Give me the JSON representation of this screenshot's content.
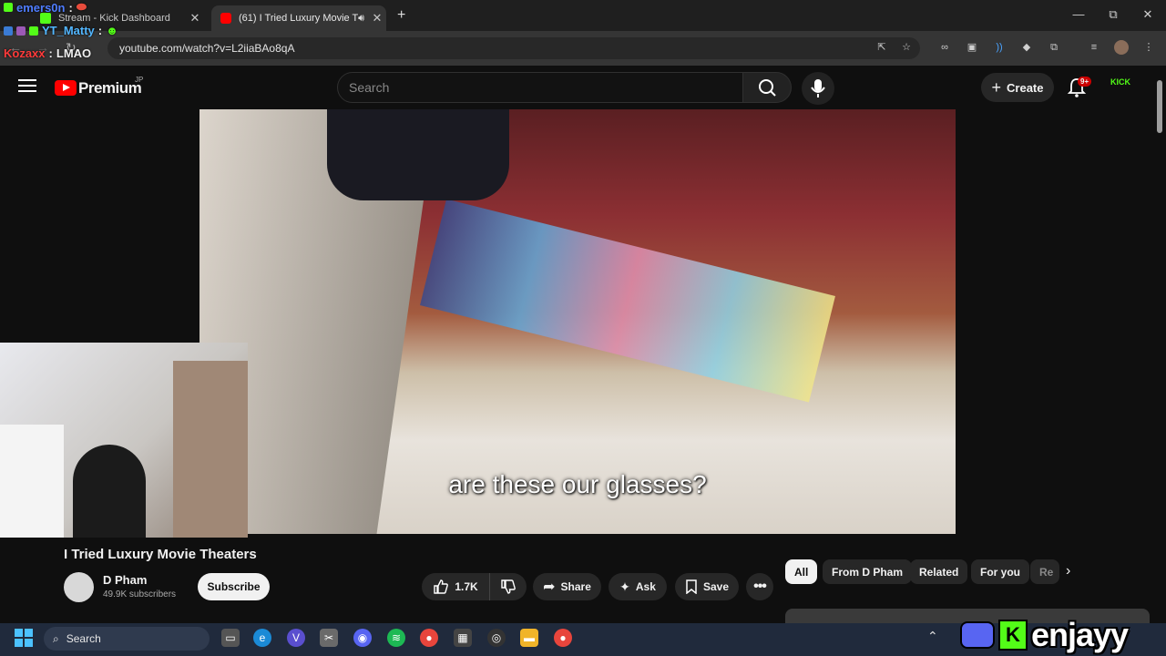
{
  "browser": {
    "tabs": [
      {
        "title": "Stream - Kick Dashboard"
      },
      {
        "title": "(61) I Tried Luxury Movie Th"
      }
    ],
    "new_tab": "+",
    "close": "✕",
    "window_buttons": [
      "—",
      "⧉",
      "✕"
    ],
    "url": "youtube.com/watch?v=L2iiaBAo8qA"
  },
  "chat_overlay": [
    {
      "user": "emers0n",
      "sep": ":",
      "color": "#4f7dff"
    },
    {
      "user": "YT_Matty",
      "sep": ":",
      "color": "#52b6ff"
    },
    {
      "user": "Kozaxx",
      "sep": ":",
      "message": "LMAO",
      "color": "#ff3b3b"
    }
  ],
  "youtube": {
    "brand": "Premium",
    "region": "JP",
    "search_placeholder": "Search",
    "create_label": "Create",
    "notification_count": "9+",
    "avatar_text": "KICK"
  },
  "video": {
    "subtitle": "are these our glasses?",
    "title": "I Tried Luxury Movie Theaters",
    "channel": "D Pham",
    "subscribers": "49.9K subscribers",
    "subscribe_label": "Subscribe",
    "likes": "1.7K",
    "share_label": "Share",
    "ask_label": "Ask",
    "save_label": "Save"
  },
  "chips": [
    "All",
    "From D Pham",
    "Related",
    "For you",
    "Re"
  ],
  "taskbar": {
    "search_label": "Search"
  },
  "branding": {
    "name": "enjayy"
  }
}
